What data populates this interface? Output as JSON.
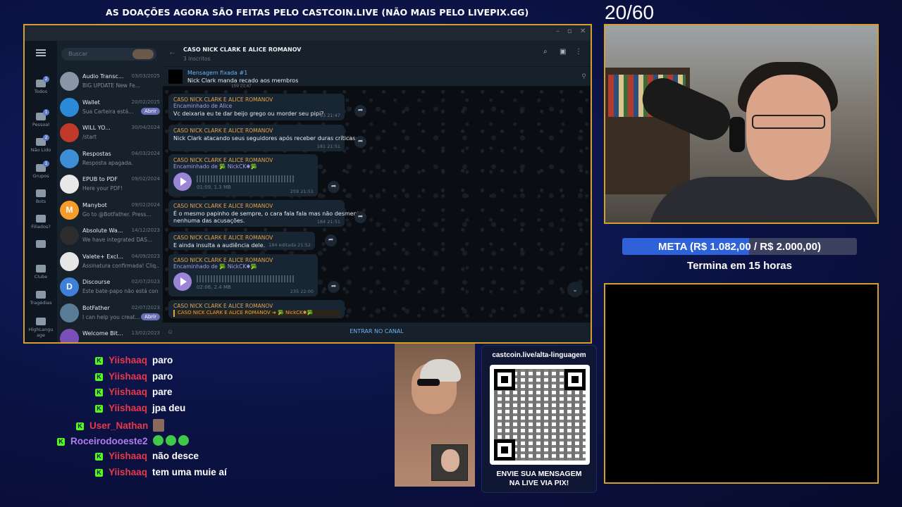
{
  "banner": "AS DOAÇÕES AGORA SÃO FEITAS PELO CASTCOIN.LIVE (NÃO MAIS PELO LIVEPIX.GG)",
  "counter": "20/60",
  "telegram": {
    "search_placeholder": "Buscar",
    "rail": [
      {
        "label": "Todos",
        "badge": "2"
      },
      {
        "label": "Pessoal",
        "badge": "1"
      },
      {
        "label": "Não Lido",
        "badge": "2"
      },
      {
        "label": "Grupos",
        "badge": "1"
      },
      {
        "label": "Bots",
        "badge": ""
      },
      {
        "label": "Filiados?",
        "badge": ""
      },
      {
        "label": "",
        "badge": ""
      },
      {
        "label": "Clube",
        "badge": ""
      },
      {
        "label": "Tragédias",
        "badge": ""
      },
      {
        "label": "HighLangu age",
        "badge": ""
      }
    ],
    "chats": [
      {
        "name": "Audio Transc...",
        "date": "03/03/2025",
        "preview": "BIG UPDATE New Fe...",
        "avatar": "",
        "color": "#8a96a8",
        "action": ""
      },
      {
        "name": "Wallet",
        "date": "20/02/2025",
        "preview": "Sua Carteira está...",
        "avatar": "",
        "color": "#2a8ad8",
        "action": "Abrir"
      },
      {
        "name": "WILL YO...",
        "date": "30/04/2024",
        "preview": "/start",
        "avatar": "",
        "color": "#c0392b",
        "action": ""
      },
      {
        "name": "Respostas",
        "date": "04/03/2024",
        "preview": "Resposta apagada.",
        "avatar": "",
        "color": "#3d8ed4",
        "action": ""
      },
      {
        "name": "EPUB to PDF",
        "date": "09/02/2024",
        "preview": "Here your PDF!",
        "avatar": "",
        "color": "#e8e8e8",
        "action": ""
      },
      {
        "name": "Manybot",
        "date": "09/02/2024",
        "preview": "Go to @BotFather. Press...",
        "avatar": "M",
        "color": "#f39c2b",
        "action": ""
      },
      {
        "name": "Absolute Wa...",
        "date": "14/12/2023",
        "preview": "We have integrated DAS...",
        "avatar": "",
        "color": "#2d2d2d",
        "action": ""
      },
      {
        "name": "Valete+ Excl...",
        "date": "04/09/2023",
        "preview": "Assinatura confirmada! Cliq...",
        "avatar": "",
        "color": "#e6e6e6",
        "action": ""
      },
      {
        "name": "Discourse",
        "date": "02/07/2023",
        "preview": "Este bate-papo não está con...",
        "avatar": "D",
        "color": "#3f7fd8",
        "action": ""
      },
      {
        "name": "BotFather",
        "date": "02/07/2023",
        "preview": "I can help you creat...",
        "avatar": "",
        "color": "#5a7b95",
        "action": "Abrir"
      },
      {
        "name": "Welcome Bit...",
        "date": "13/02/2023",
        "preview": "",
        "avatar": "",
        "color": "#7b4fb8",
        "action": ""
      }
    ],
    "channel": {
      "title": "CASO NICK CLARK E ALICE ROMANOV",
      "subtitle": "3 inscritos",
      "pinned_label": "Mensagem fixada #1",
      "pinned_text": "Nick Clark manda recado aos membros",
      "top_meta": "159  21:47",
      "join_label": "ENTRAR NO CANAL"
    },
    "messages": [
      {
        "author": "CASO NICK CLARK E ALICE ROMANOV",
        "fwd": "Encaminhado de Alice",
        "text": "Vc deixaria eu te dar beijo grego ou morder seu pipi?",
        "meta": "93  21:47"
      },
      {
        "author": "CASO NICK CLARK E ALICE ROMANOV",
        "fwd": "",
        "text": "Nick Clark atacando seus seguidores após receber duras críticas:",
        "meta": "181  21:51"
      },
      {
        "author": "CASO NICK CLARK E ALICE ROMANOV",
        "fwd": "Encaminhado de 🥦 NickCK✱🥦",
        "voice": "01:09, 1.3 MB",
        "meta": "259  21:51"
      },
      {
        "author": "CASO NICK CLARK E ALICE ROMANOV",
        "fwd": "",
        "text": "É o mesmo papinho de sempre, o cara fala fala mas não desmente",
        "text2": "nenhuma das acusações.",
        "meta": "184  21:51"
      },
      {
        "author": "CASO NICK CLARK E ALICE ROMANOV",
        "fwd": "",
        "text": "E ainda insulta a audiência dele.",
        "meta": "184  editada 21:52"
      },
      {
        "author": "CASO NICK CLARK E ALICE ROMANOV",
        "fwd": "Encaminhado de 🥦 NickCK✱🥦",
        "voice": "02:06, 2.4 MB",
        "meta": "235  22:00"
      },
      {
        "author": "CASO NICK CLARK E ALICE ROMANOV",
        "quote": "CASO NICK CLARK E ALICE ROMANOV ➜ 🥦 NickCK✱🥦"
      }
    ]
  },
  "goal": {
    "text": "META (R$ 1.082,00 / R$ 2.000,00)",
    "progress": 0.541,
    "subtitle": "Termina em 15 horas",
    "fill_color": "#2f61d8"
  },
  "chat": [
    {
      "user": "Yiishaaq",
      "color": "#e8394b",
      "message": "paro",
      "emotes": 0
    },
    {
      "user": "Yiishaaq",
      "color": "#e8394b",
      "message": "paro",
      "emotes": 0
    },
    {
      "user": "Yiishaaq",
      "color": "#e8394b",
      "message": "pare",
      "emotes": 0
    },
    {
      "user": "Yiishaaq",
      "color": "#e8394b",
      "message": "jpa deu",
      "emotes": 0
    },
    {
      "user": "User_Nathan",
      "color": "#e8394b",
      "message": "",
      "emotes": "face"
    },
    {
      "user": "Roceirodooeste2",
      "color": "#b07cf0",
      "message": "",
      "emotes": 3
    },
    {
      "user": "Yiishaaq",
      "color": "#e8394b",
      "message": "não desce",
      "emotes": 0
    },
    {
      "user": "Yiishaaq",
      "color": "#e8394b",
      "message": "tem uma muie aí",
      "emotes": 0
    }
  ],
  "qr": {
    "url": "castcoin.live/alta-linguagem",
    "caption_1": "ENVIE SUA MENSAGEM",
    "caption_2": "NA LIVE VIA PIX!"
  }
}
